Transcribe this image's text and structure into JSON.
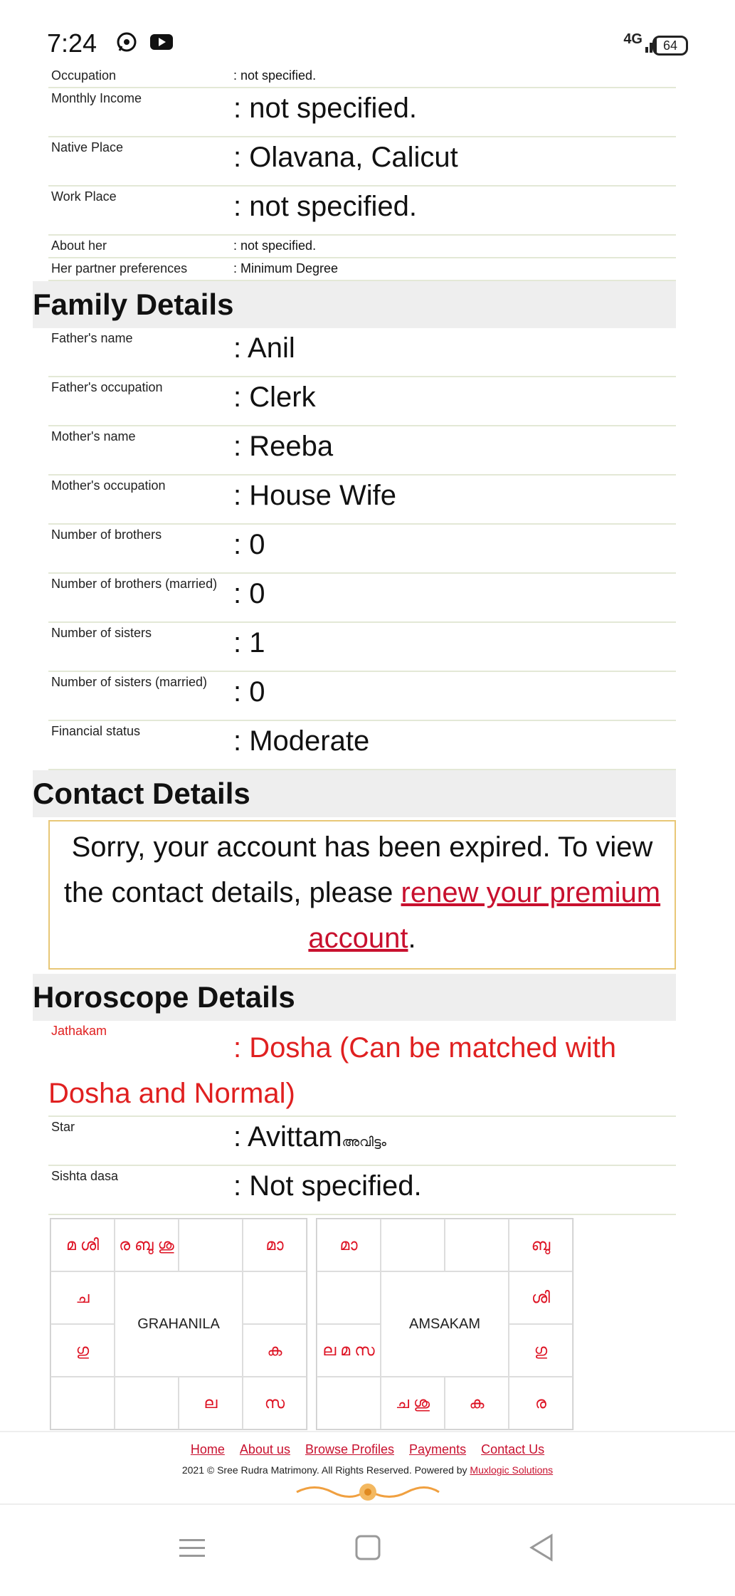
{
  "status": {
    "time": "7:24",
    "network": "4G",
    "battery": "64"
  },
  "basic_rows": [
    {
      "label": "Occupation",
      "value": ": not specified."
    },
    {
      "label": "Monthly Income",
      "value": ": not specified."
    },
    {
      "label": "Native Place",
      "value": ": Olavana, Calicut"
    },
    {
      "label": "Work Place",
      "value": ": not specified."
    },
    {
      "label": "About her",
      "value": ": not specified."
    },
    {
      "label": "Her partner preferences",
      "value": ": Minimum Degree"
    }
  ],
  "family": {
    "title": "Family Details",
    "rows": [
      {
        "label": "Father's name",
        "value": ": Anil"
      },
      {
        "label": "Father's occupation",
        "value": ": Clerk"
      },
      {
        "label": "Mother's name",
        "value": ": Reeba"
      },
      {
        "label": "Mother's occupation",
        "value": ": House Wife"
      },
      {
        "label": "Number of brothers",
        "value": ": 0"
      },
      {
        "label": "Number of brothers (married)",
        "value": ": 0"
      },
      {
        "label": "Number of sisters",
        "value": ": 1"
      },
      {
        "label": "Number of sisters (married)",
        "value": ": 0"
      },
      {
        "label": "Financial status",
        "value": ": Moderate"
      }
    ]
  },
  "contact": {
    "title": "Contact Details",
    "text_before": "Sorry, your account has been expired. To view the contact details, please ",
    "link": "renew your premium account",
    "text_after": "."
  },
  "horoscope": {
    "title": "Horoscope Details",
    "jathakam_label": "Jathakam",
    "jathakam_value": ": Dosha (Can be matched with Dosha and Normal)",
    "star_label": "Star",
    "star_value": ": Avittam",
    "star_value_ml": "അവിട്ടം",
    "sishta_label": "Sishta dasa",
    "sishta_value": ": Not specified.",
    "grahanila": {
      "center": "GRAHANILA",
      "cells": [
        "മ ശി",
        "ര ബു ശു",
        "",
        "മാ",
        "ച",
        "",
        "ഗു",
        "ക",
        "",
        "",
        "ല",
        "സ"
      ]
    },
    "amsakam": {
      "center": "AMSAKAM",
      "cells": [
        "മാ",
        "",
        "",
        "ബു",
        "",
        "ശി",
        "ല മ സ",
        "ഗു",
        "",
        "ച ശു",
        "ക",
        "ര"
      ]
    }
  },
  "footer": {
    "links": [
      "Home",
      "About us",
      "Browse Profiles",
      "Payments",
      "Contact Us"
    ],
    "copyright": "2021 © Sree Rudra Matrimony. All Rights Reserved. Powered by ",
    "powered_link": "Muxlogic Solutions"
  }
}
